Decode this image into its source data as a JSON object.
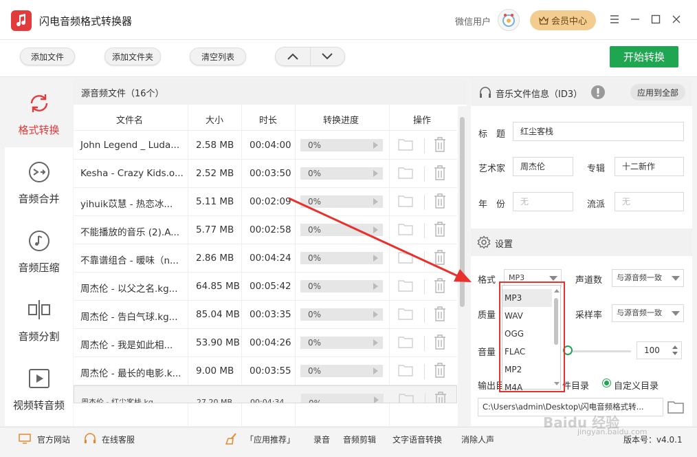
{
  "app": {
    "title": "闪电音频格式转换器",
    "user_name": "微信用户",
    "vip_label": "会员中心"
  },
  "toolbar": {
    "add_file": "添加文件",
    "add_folder": "添加文件夹",
    "clear_list": "清空列表",
    "start": "开始转换"
  },
  "sidebar": {
    "items": [
      {
        "label": "格式转换",
        "icon": "refresh-icon",
        "active": true
      },
      {
        "label": "音频合并",
        "icon": "merge-icon"
      },
      {
        "label": "音频压缩",
        "icon": "music-note-icon"
      },
      {
        "label": "音频分割",
        "icon": "split-icon"
      },
      {
        "label": "视频转音频",
        "icon": "video-play-icon"
      }
    ]
  },
  "filelist": {
    "title": "源音频文件（16个）",
    "columns": [
      "文件名",
      "大小",
      "时长",
      "转换进度",
      "操作"
    ],
    "rows": [
      {
        "name": "John Legend _ Luda...",
        "size": "2.58 MB",
        "duration": "00:04:00",
        "progress": "0%"
      },
      {
        "name": "Kesha - Crazy Kids.o...",
        "size": "2.52 MB",
        "duration": "00:03:50",
        "progress": "0%"
      },
      {
        "name": "yihuik苡慧 - 热恋冰...",
        "size": "5.11 MB",
        "duration": "00:02:09",
        "progress": "0%"
      },
      {
        "name": "不能播放的音乐 (2).A...",
        "size": "5.77 MB",
        "duration": "00:02:58",
        "progress": "0%"
      },
      {
        "name": "不靠谱组合 - 暖味（n...",
        "size": "2.86 MB",
        "duration": "00:04:24",
        "progress": "0%"
      },
      {
        "name": "周杰伦 - 以父之名.kg...",
        "size": "64.85 MB",
        "duration": "00:05:42",
        "progress": "0%"
      },
      {
        "name": "周杰伦 - 告白气球.kg...",
        "size": "85.04 MB",
        "duration": "00:03:35",
        "progress": "0%"
      },
      {
        "name": "周杰伦 - 我是如此相...",
        "size": "53.90 MB",
        "duration": "00:04:26",
        "progress": "0%"
      },
      {
        "name": "周杰伦 - 最长的电影.k...",
        "size": "9.00 MB",
        "duration": "00:03:55",
        "progress": "0%"
      },
      {
        "name": "周杰伦 - 红尘客栈.kg...",
        "size": "27.20 MB",
        "duration": "00:04:34",
        "progress": "0%",
        "selected": true
      }
    ]
  },
  "id3": {
    "title": "音乐文件信息（ID3）",
    "apply_all": "应用到全部",
    "song_label": "标　题",
    "song_value": "红尘客栈",
    "artist_label": "艺术家",
    "artist_value": "周杰伦",
    "album_label": "专辑",
    "album_value": "十二新作",
    "year_label": "年　份",
    "year_placeholder": "无",
    "genre_label": "流派",
    "genre_placeholder": "无"
  },
  "settings": {
    "title": "设置",
    "format_label": "格式",
    "format_value": "MP3",
    "channels_label": "声道数",
    "channels_value": "与源音频一致",
    "quality_label": "质量",
    "samplerate_label": "采样率",
    "samplerate_value": "与源音频一致",
    "volume_label": "音量",
    "volume_value": "100",
    "output_label": "输出目",
    "source_dir_fragment": "件目录",
    "custom_dir": "自定义目录",
    "output_path": "C:\\Users\\admin\\Desktop\\闪电音频格式转..."
  },
  "format_dropdown": {
    "options": [
      "MP3",
      "WAV",
      "OGG",
      "FLAC",
      "MP2",
      "M4A"
    ],
    "highlighted": 0
  },
  "statusbar": {
    "website": "官方网站",
    "support": "在线客服",
    "recommend": "「应用推荐」",
    "record": "录音",
    "audio_edit": "音频剪辑",
    "tts": "文字语音转换",
    "vocal_remove": "消除人声",
    "version": "版本号：v4.0.1"
  },
  "watermark": {
    "text": "Baidu 经验",
    "url": "jingyan.baidu.com"
  },
  "colors": {
    "accent_red": "#e43a3a",
    "start_green": "#1ea650",
    "vip_gold": "#f3cc90",
    "annotation_red": "#e8302c"
  }
}
